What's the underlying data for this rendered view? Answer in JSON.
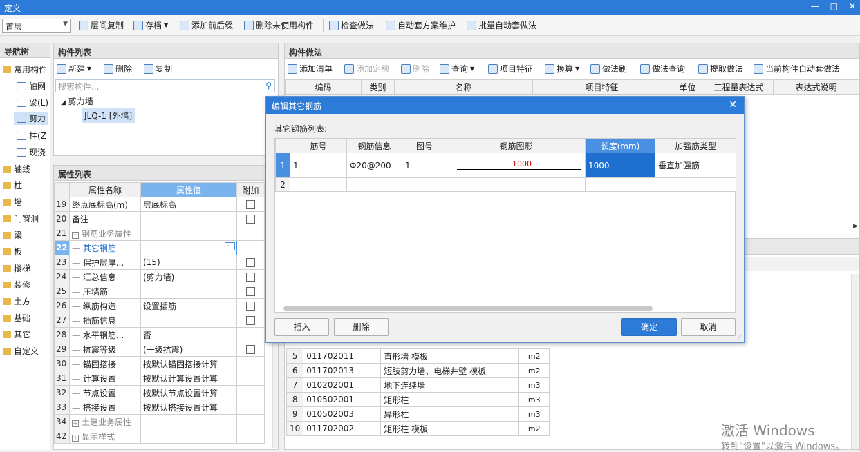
{
  "window": {
    "title": "定义",
    "controls": [
      "—",
      "□",
      "✕"
    ]
  },
  "toolbar": {
    "floor": "首层",
    "items": [
      "层间复制",
      "存档",
      "添加前后缀",
      "删除未使用构件",
      "检查做法",
      "自动套方案维护",
      "批量自动套做法"
    ]
  },
  "nav": {
    "title": "导航树",
    "top": "常用构件",
    "subs": [
      "轴网",
      "梁(L)",
      "剪力",
      "柱(Z",
      "现浇"
    ],
    "groups": [
      "轴线",
      "柱",
      "墙",
      "门窗洞",
      "梁",
      "板",
      "楼梯",
      "装修",
      "土方",
      "基础",
      "其它",
      "自定义"
    ]
  },
  "components": {
    "title": "构件列表",
    "new": "新建",
    "delete": "删除",
    "copy": "复制",
    "search_placeholder": "搜索构件...",
    "tree_root": "剪力墙",
    "tree_item": "JLQ-1 [外墙]"
  },
  "properties": {
    "title": "属性列表",
    "headers": [
      "属性名称",
      "属性值",
      "附加"
    ],
    "rows": [
      {
        "n": "19",
        "name": "终点底标高(m)",
        "value": "层底标高",
        "chk": true
      },
      {
        "n": "20",
        "name": "备注",
        "value": "",
        "chk": true
      },
      {
        "n": "21",
        "name": "钢筋业务属性",
        "value": "",
        "chk": false
      },
      {
        "n": "22",
        "name": "其它钢筋",
        "value": "",
        "chk": false
      },
      {
        "n": "23",
        "name": "保护层厚...",
        "value": "(15)",
        "chk": true
      },
      {
        "n": "24",
        "name": "汇总信息",
        "value": "(剪力墙)",
        "chk": true
      },
      {
        "n": "25",
        "name": "压墙筋",
        "value": "",
        "chk": true
      },
      {
        "n": "26",
        "name": "纵筋构造",
        "value": "设置插筋",
        "chk": true
      },
      {
        "n": "27",
        "name": "插筋信息",
        "value": "",
        "chk": true
      },
      {
        "n": "28",
        "name": "水平钢筋...",
        "value": "否",
        "chk": false
      },
      {
        "n": "29",
        "name": "抗震等级",
        "value": "(一级抗震)",
        "chk": true
      },
      {
        "n": "30",
        "name": "锚固搭接",
        "value": "按默认锚固搭接计算",
        "chk": false
      },
      {
        "n": "31",
        "name": "计算设置",
        "value": "按默认计算设置计算",
        "chk": false
      },
      {
        "n": "32",
        "name": "节点设置",
        "value": "按默认节点设置计算",
        "chk": false
      },
      {
        "n": "33",
        "name": "搭接设置",
        "value": "按默认搭接设置计算",
        "chk": false
      },
      {
        "n": "34",
        "name": "土建业务属性",
        "value": "",
        "chk": false
      },
      {
        "n": "42",
        "name": "显示样式",
        "value": "",
        "chk": false
      }
    ]
  },
  "method": {
    "title": "构件做法",
    "tools": [
      "添加清单",
      "添加定额",
      "删除",
      "查询",
      "项目特征",
      "换算",
      "做法刷",
      "做法查询",
      "提取做法",
      "当前构件自动套做法"
    ],
    "headers": [
      "编码",
      "类别",
      "名称",
      "项目特征",
      "单位",
      "工程量表达式",
      "表达式说明"
    ],
    "lower_rows": [
      {
        "n": "5",
        "code": "011702011",
        "name": "直形墙 模板",
        "unit": "m2"
      },
      {
        "n": "6",
        "code": "011702013",
        "name": "短肢剪力墙、电梯井壁 模板",
        "unit": "m2"
      },
      {
        "n": "7",
        "code": "010202001",
        "name": "地下连续墙",
        "unit": "m3"
      },
      {
        "n": "8",
        "code": "010502001",
        "name": "矩形柱",
        "unit": "m3"
      },
      {
        "n": "9",
        "code": "010502003",
        "name": "异形柱",
        "unit": "m3"
      },
      {
        "n": "10",
        "code": "011702002",
        "name": "矩形柱 模板",
        "unit": "m2"
      }
    ]
  },
  "dialog": {
    "title": "编辑其它钢筋",
    "list_label": "其它钢筋列表:",
    "headers": [
      "筋号",
      "钢筋信息",
      "图号",
      "钢筋图形",
      "长度(mm)",
      "加强筋类型"
    ],
    "rows": [
      {
        "n": "1",
        "bar_no": "1",
        "info": "Φ20@200",
        "fig": "1",
        "shape_len": "1000",
        "length": "1000",
        "type": "垂直加强筋"
      },
      {
        "n": "2",
        "bar_no": "",
        "info": "",
        "fig": "",
        "shape_len": "",
        "length": "",
        "type": ""
      }
    ],
    "insert": "插入",
    "delete": "删除",
    "ok": "确定",
    "cancel": "取消"
  },
  "watermark": {
    "line1": "激活 Windows",
    "line2": "转到\"设置\"以激活 Windows。"
  }
}
